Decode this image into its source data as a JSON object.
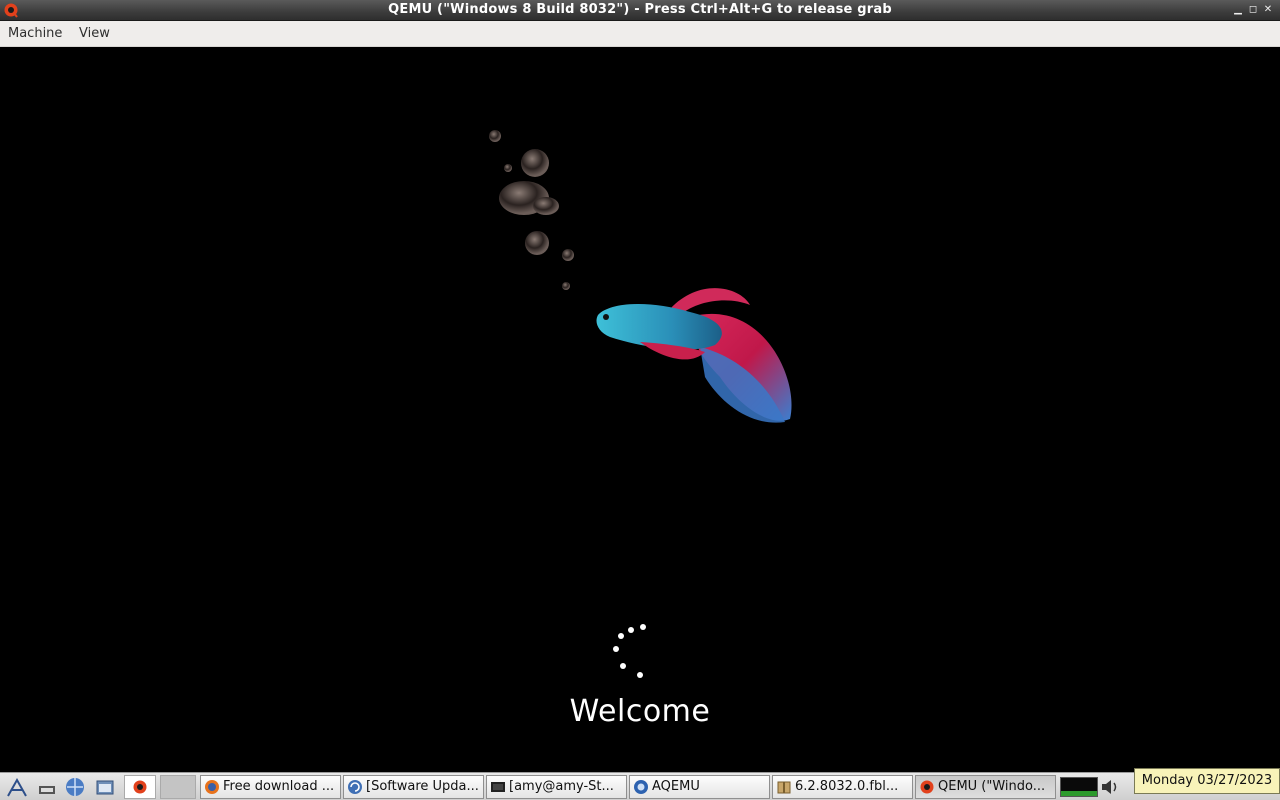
{
  "window": {
    "title": "QEMU (\"Windows 8 Build 8032\") - Press Ctrl+Alt+G to release grab",
    "controls": [
      "minimize",
      "restore",
      "close"
    ]
  },
  "menubar": {
    "items": [
      "Machine",
      "View"
    ]
  },
  "guest": {
    "welcome_text": "Welcome"
  },
  "taskbar": {
    "launchers": [
      "menu-icon",
      "show-desktop-icon",
      "browser-icon",
      "file-manager-icon",
      "qemu-icon"
    ],
    "tasks": [
      {
        "label": "Free download ...",
        "icon": "firefox-icon"
      },
      {
        "label": "[Software Upda...",
        "icon": "update-icon"
      },
      {
        "label": "[amy@amy-St...",
        "icon": "terminal-icon"
      },
      {
        "label": "AQEMU",
        "icon": "aqemu-icon"
      },
      {
        "label": "6.2.8032.0.fbl...",
        "icon": "archive-icon"
      },
      {
        "label": "QEMU (\"Windo...",
        "icon": "qemu-icon"
      }
    ],
    "active_task_index": 5,
    "cpu_usage_fraction": 0.3
  },
  "clock": {
    "tooltip": "Monday 03/27/2023"
  }
}
